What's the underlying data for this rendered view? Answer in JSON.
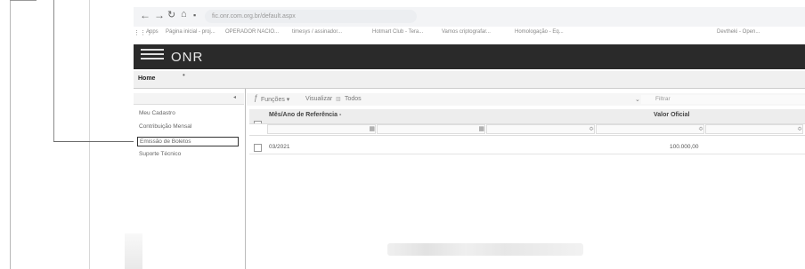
{
  "browser": {
    "nav_icons": [
      "back-icon",
      "forward-icon",
      "reload-icon",
      "home-icon",
      "lock-icon"
    ],
    "url": "fic.onr.com.org.br/default.aspx",
    "bookmarks": [
      "Apps",
      "Página inicial - proj...",
      "OPERADOR NACIO...",
      "timesys / assinador...",
      "Hotmart Club - Tera...",
      "Vamos criptografar...",
      "Homologação - Eq...",
      "Devtheki - Open..."
    ]
  },
  "header": {
    "logo_text": "ONR"
  },
  "tabs": {
    "home_label": "Home",
    "extra": "•"
  },
  "sidebar": {
    "collapse_arrow": "◂",
    "items": [
      {
        "label": "Meu Cadastro"
      },
      {
        "label": "Contribuição Mensal"
      },
      {
        "label": "Emissão de Boletos"
      },
      {
        "label": "Suporte Técnico"
      }
    ]
  },
  "toolbar": {
    "functions_label": "Funções ▾",
    "view_label": "Visualizar",
    "view_value": "Todos",
    "filter_arrow": "⌄",
    "filter_label": "Filtrar"
  },
  "grid": {
    "columns": [
      "Mês/Ano de Referência",
      "Valor Oficial"
    ],
    "filter_symbols": [
      "▦",
      "▦",
      "≎",
      "≎",
      "≎"
    ],
    "rows": [
      {
        "month": "03/2021",
        "value": "100.000,00"
      }
    ]
  },
  "colors": {
    "header_bg": "#2a2a2a",
    "accent": "#e8e8e8"
  }
}
